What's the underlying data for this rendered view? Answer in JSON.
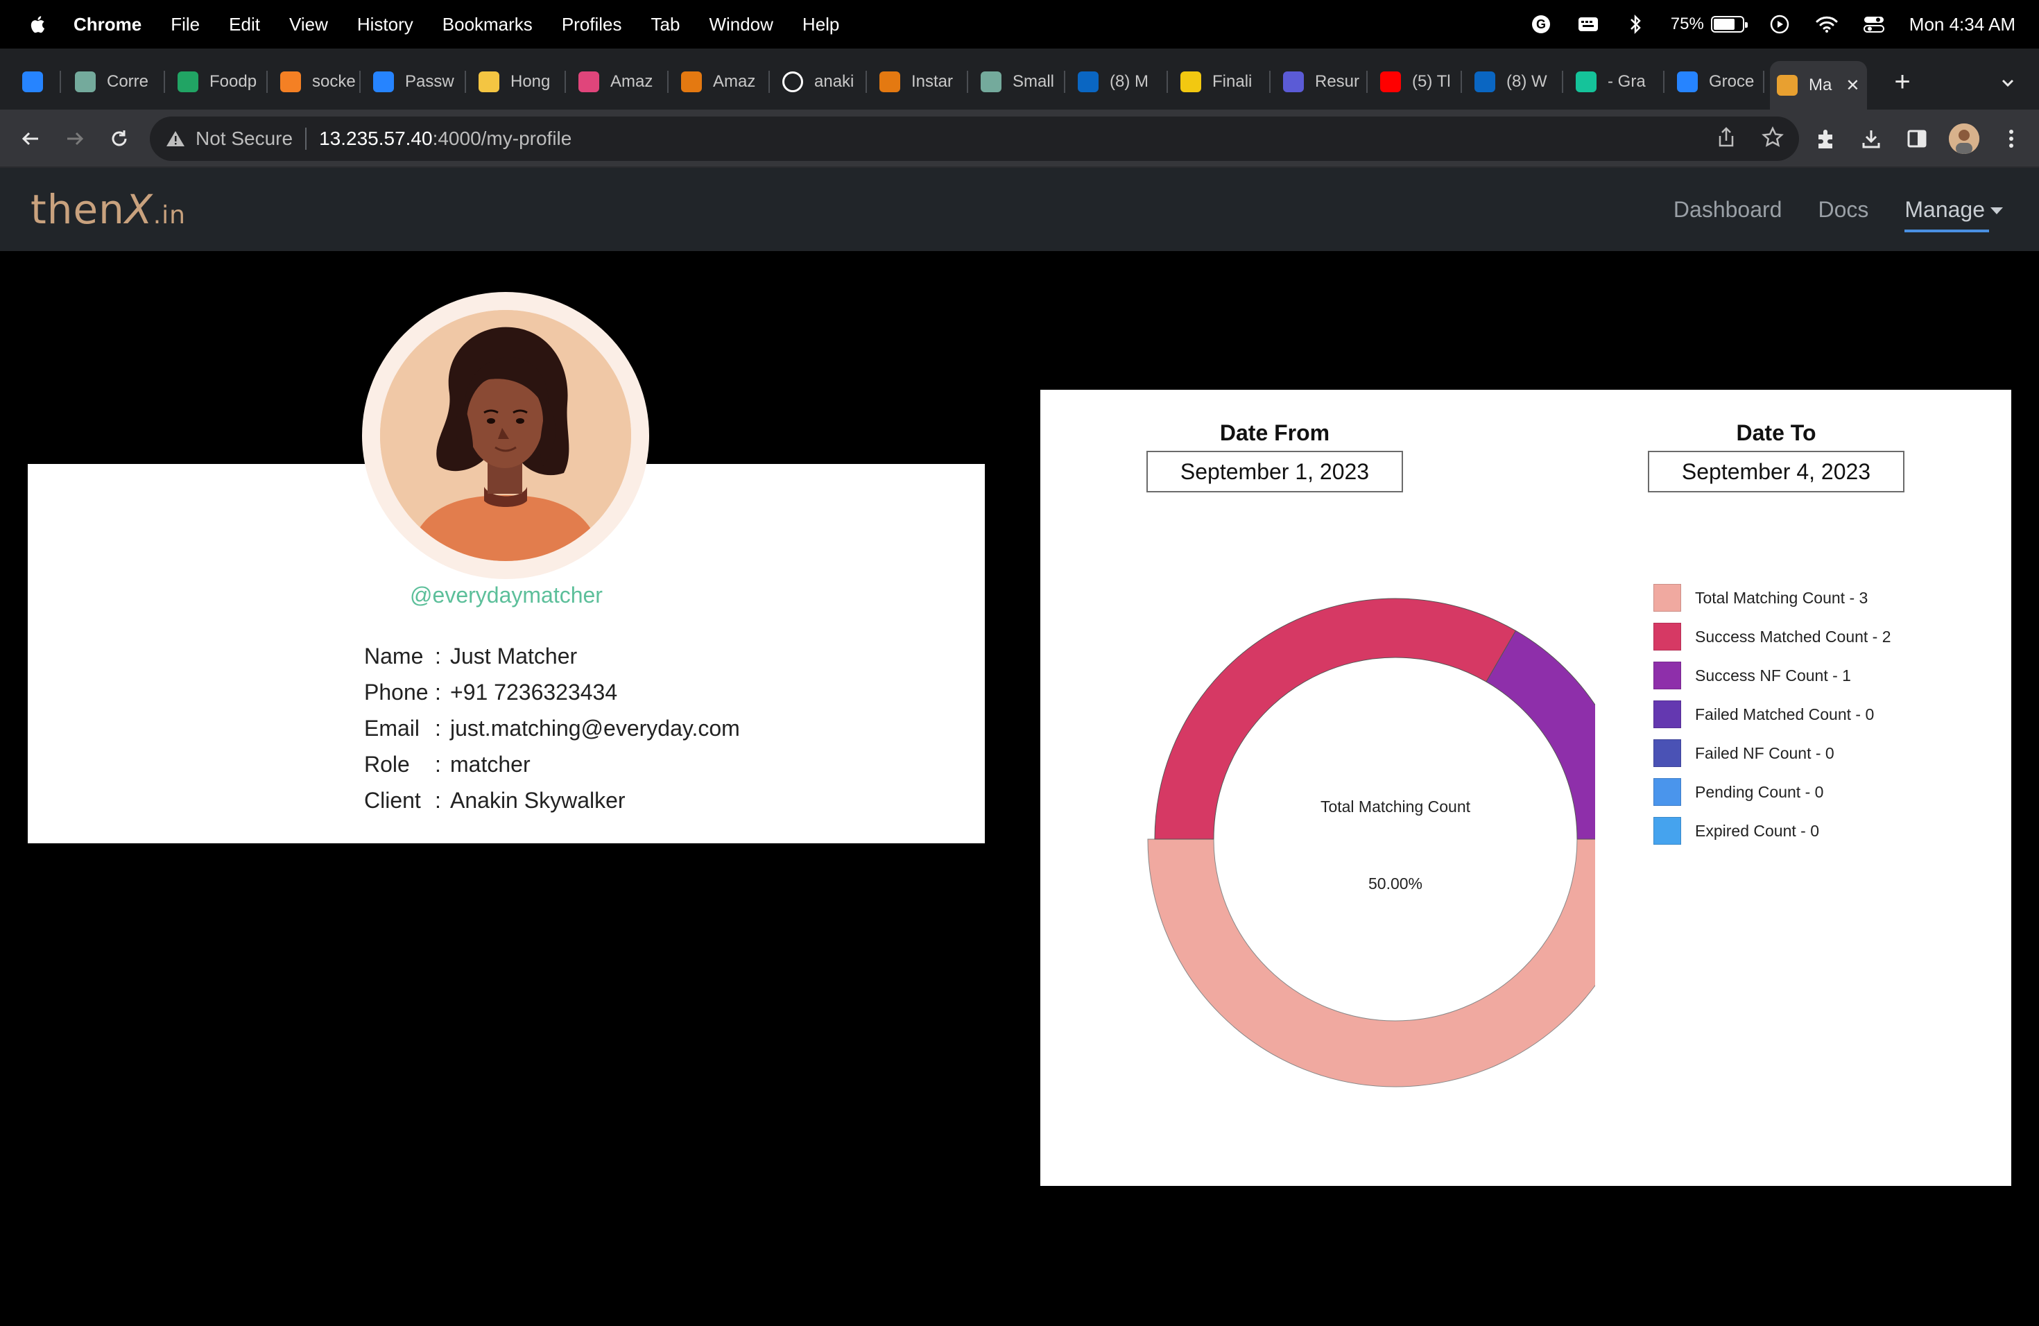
{
  "menubar": {
    "app": "Chrome",
    "items": [
      "File",
      "Edit",
      "View",
      "History",
      "Bookmarks",
      "Profiles",
      "Tab",
      "Window",
      "Help"
    ],
    "battery": "75%",
    "battery_level": 0.75,
    "clock": "Mon 4:34 AM"
  },
  "tabs": [
    {
      "title": "",
      "icon": "jira-icon",
      "color": "#2684ff"
    },
    {
      "title": "Corre",
      "icon": "chatgpt-icon",
      "color": "#74aa9c"
    },
    {
      "title": "Foodp",
      "icon": "sheets-icon",
      "color": "#21a464"
    },
    {
      "title": "socke",
      "icon": "stackoverflow-icon",
      "color": "#f48024"
    },
    {
      "title": "Passw",
      "icon": "confluence-icon",
      "color": "#2684ff"
    },
    {
      "title": "Hong",
      "icon": "egg-icon",
      "color": "#f4c542"
    },
    {
      "title": "Amaz",
      "icon": "calendar-icon",
      "color": "#e0457b"
    },
    {
      "title": "Amaz",
      "icon": "aws-icon",
      "color": "#e47911"
    },
    {
      "title": "anaki",
      "icon": "github-icon",
      "color": "#ffffff"
    },
    {
      "title": "Instar",
      "icon": "aws-instance-icon",
      "color": "#e47911"
    },
    {
      "title": "Small",
      "icon": "chatgpt-icon",
      "color": "#74aa9c"
    },
    {
      "title": "(8) M",
      "icon": "linkedin-icon",
      "color": "#0a66c2"
    },
    {
      "title": "Finali",
      "icon": "powerbi-icon",
      "color": "#f2c811"
    },
    {
      "title": "Resur",
      "icon": "resume-icon",
      "color": "#5b5bd6"
    },
    {
      "title": "(5) Tl",
      "icon": "youtube-icon",
      "color": "#ff0000"
    },
    {
      "title": "(8) W",
      "icon": "linkedin-icon",
      "color": "#0a66c2"
    },
    {
      "title": "- Gra",
      "icon": "grammarly-icon",
      "color": "#15c39a"
    },
    {
      "title": "Groce",
      "icon": "confluence-icon",
      "color": "#2684ff"
    },
    {
      "title": "Ma",
      "icon": "thenx-icon",
      "color": "#e8a030",
      "active": true
    }
  ],
  "address": {
    "security": "Not Secure",
    "host": "13.235.57.40",
    "path": ":4000/my-profile"
  },
  "app": {
    "logo_main": "then",
    "logo_x": "X",
    "logo_suffix": ".in",
    "nav": [
      {
        "label": "Dashboard"
      },
      {
        "label": "Docs"
      },
      {
        "label": "Manage"
      }
    ]
  },
  "profile": {
    "handle": "@everydaymatcher",
    "fields": [
      {
        "key": "Name",
        "value": "Just Matcher"
      },
      {
        "key": "Phone",
        "value": "+91 7236323434"
      },
      {
        "key": "Email",
        "value": "just.matching@everyday.com"
      },
      {
        "key": "Role",
        "value": "matcher"
      },
      {
        "key": "Client",
        "value": "Anakin Skywalker"
      }
    ],
    "separator": ":"
  },
  "filters": {
    "date_from_label": "Date From",
    "date_from": "September 1, 2023",
    "date_to_label": "Date To",
    "date_to": "September 4, 2023"
  },
  "chart_data": {
    "type": "pie",
    "variant": "half-doughnut",
    "center_label": "Total Matching Count",
    "center_value": "50.00%",
    "series": [
      {
        "name": "Total Matching Count - 3",
        "value": 3,
        "color": "#f0a9a0"
      },
      {
        "name": "Success Matched Count - 2",
        "value": 2,
        "color": "#d63964"
      },
      {
        "name": "Success NF Count - 1",
        "value": 1,
        "color": "#8e2faa"
      },
      {
        "name": "Failed Matched Count - 0",
        "value": 0,
        "color": "#6438b0"
      },
      {
        "name": "Failed NF Count - 0",
        "value": 0,
        "color": "#4a52b5"
      },
      {
        "name": "Pending Count - 0",
        "value": 0,
        "color": "#4a95ec"
      },
      {
        "name": "Expired Count - 0",
        "value": 0,
        "color": "#45a3ee"
      }
    ],
    "legend_position": "right"
  }
}
